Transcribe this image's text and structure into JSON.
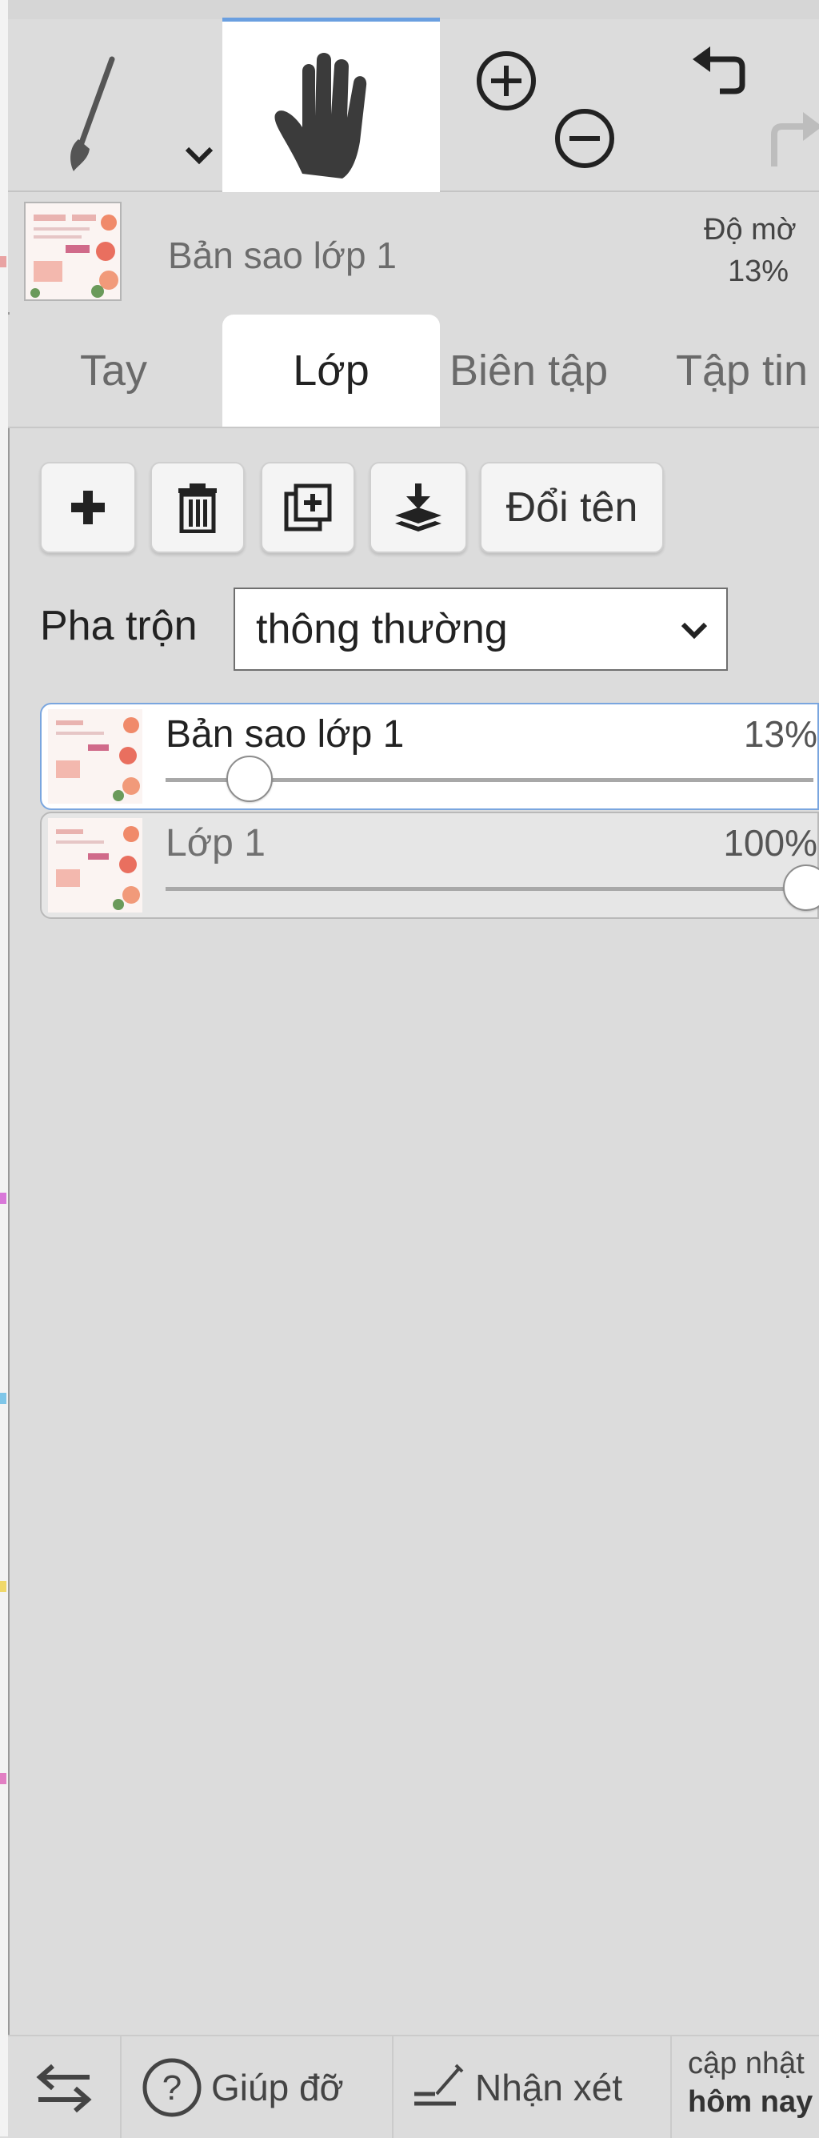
{
  "toolbar": {
    "brush_icon": "brush-icon",
    "brush_dropdown_icon": "chevron-down-icon",
    "hand_icon": "hand-icon",
    "zoom_in_icon": "zoom-in-icon",
    "zoom_out_icon": "zoom-out-icon",
    "undo_icon": "undo-icon",
    "redo_icon": "redo-icon",
    "active_accent": "#6a9fe0"
  },
  "layer_info": {
    "name": "Bản sao lớp 1",
    "opacity_label": "Độ mờ",
    "opacity_value": "13%"
  },
  "tabs": [
    {
      "label": "Tay",
      "active": false
    },
    {
      "label": "Lớp",
      "active": true
    },
    {
      "label": "Biên tập",
      "active": false
    },
    {
      "label": "Tập tin",
      "active": false
    }
  ],
  "actions": {
    "add_icon": "plus-icon",
    "delete_icon": "trash-icon",
    "duplicate_icon": "duplicate-icon",
    "merge_icon": "merge-down-icon",
    "rename_label": "Đổi tên"
  },
  "blend": {
    "label": "Pha trộn",
    "selected": "thông thường"
  },
  "layers": [
    {
      "name": "Bản sao lớp 1",
      "opacity": "13%",
      "opacity_value": 0.13,
      "active": true
    },
    {
      "name": "Lớp 1",
      "opacity": "100%",
      "opacity_value": 1.0,
      "active": false
    }
  ],
  "footer": {
    "swap_icon": "swap-arrows-icon",
    "help_label": "Giúp đỡ",
    "feedback_label": "Nhận xét",
    "update_line1": "cập nhật",
    "update_line2": "hôm nay"
  }
}
